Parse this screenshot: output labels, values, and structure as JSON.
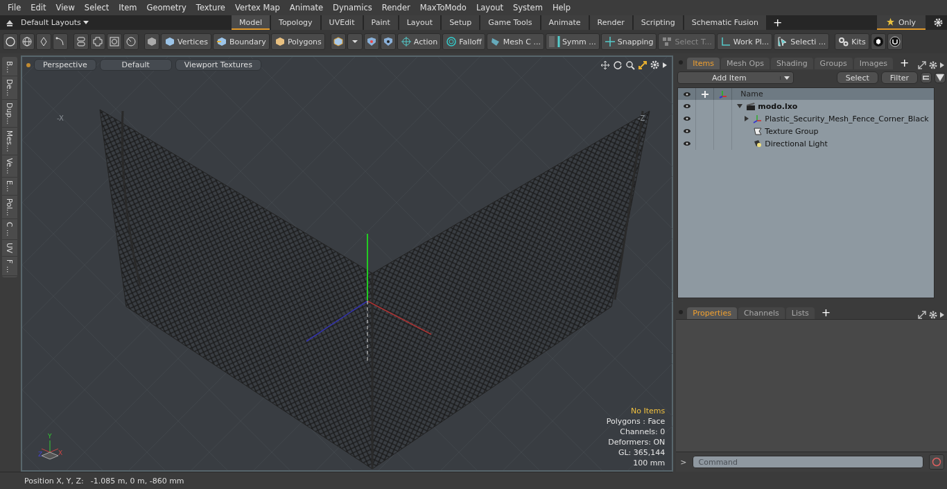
{
  "menu_bar": [
    "File",
    "Edit",
    "View",
    "Select",
    "Item",
    "Geometry",
    "Texture",
    "Vertex Map",
    "Animate",
    "Dynamics",
    "Render",
    "MaxToModo",
    "Layout",
    "System",
    "Help"
  ],
  "layout_bar": {
    "layouts_menu": "Default Layouts",
    "tabs": [
      {
        "label": "Model",
        "selected": true
      },
      {
        "label": "Topology",
        "selected": false
      },
      {
        "label": "UVEdit",
        "selected": false
      },
      {
        "label": "Paint",
        "selected": false
      },
      {
        "label": "Layout",
        "selected": false
      },
      {
        "label": "Setup",
        "selected": false
      },
      {
        "label": "Game Tools",
        "selected": false
      },
      {
        "label": "Animate",
        "selected": false
      },
      {
        "label": "Render",
        "selected": false
      },
      {
        "label": "Scripting",
        "selected": false
      },
      {
        "label": "Schematic Fusion",
        "selected": false
      }
    ],
    "add_tab": "+",
    "only_button": "Only"
  },
  "toolbar": [
    {
      "kind": "icon"
    },
    {
      "kind": "icon"
    },
    {
      "kind": "icon"
    },
    {
      "kind": "icon"
    },
    {
      "kind": "icon"
    },
    {
      "kind": "icon"
    },
    {
      "kind": "icon"
    },
    {
      "kind": "icon"
    },
    {
      "kind": "icon"
    },
    {
      "kind": "text",
      "label": "Vertices",
      "disabled": false
    },
    {
      "kind": "text",
      "label": "Boundary",
      "disabled": false
    },
    {
      "kind": "text",
      "label": "Polygons",
      "disabled": false
    },
    {
      "kind": "icon"
    },
    {
      "kind": "icon"
    },
    {
      "kind": "icon"
    },
    {
      "kind": "icon"
    },
    {
      "kind": "text",
      "label": "Action",
      "disabled": false
    },
    {
      "kind": "text",
      "label": "Falloff",
      "disabled": false
    },
    {
      "kind": "text",
      "label": "Mesh C ...",
      "disabled": false
    },
    {
      "kind": "text",
      "label": "Symm ...",
      "disabled": false
    },
    {
      "kind": "text",
      "label": "Snapping",
      "disabled": false
    },
    {
      "kind": "text",
      "label": "Select T...",
      "disabled": true
    },
    {
      "kind": "text",
      "label": "Work Pl...",
      "disabled": false
    },
    {
      "kind": "text",
      "label": "Selecti ...",
      "disabled": false
    },
    {
      "kind": "text",
      "label": "Kits",
      "disabled": false
    },
    {
      "kind": "icon"
    },
    {
      "kind": "icon"
    }
  ],
  "side_tabs": [
    "B...",
    "De...",
    "Dup...",
    "Mes...",
    "Ve...",
    "E...",
    "Pol...",
    "C ...",
    "UV",
    "F ..."
  ],
  "viewport": {
    "buttons": [
      "Perspective",
      "Default",
      "Viewport Textures"
    ],
    "axis_labels": [
      "-X",
      "-Z"
    ],
    "gizmo_labels": [
      "Y",
      "Z",
      "X"
    ],
    "info": [
      {
        "text": "No Items",
        "highlight": true
      },
      {
        "text": "Polygons : Face",
        "highlight": false
      },
      {
        "text": "Channels: 0",
        "highlight": false
      },
      {
        "text": "Deformers: ON",
        "highlight": false
      },
      {
        "text": "GL: 365,144",
        "highlight": false
      },
      {
        "text": "100 mm",
        "highlight": false
      }
    ]
  },
  "items_panel": {
    "tabs": [
      {
        "label": "Items",
        "selected": true
      },
      {
        "label": "Mesh Ops",
        "selected": false
      },
      {
        "label": "Shading",
        "selected": false
      },
      {
        "label": "Groups",
        "selected": false
      },
      {
        "label": "Images",
        "selected": false
      }
    ],
    "add_tab": "+",
    "add_item": "Add Item",
    "select_button": "Select",
    "filter_button": "Filter",
    "name_column": "Name",
    "tree": [
      {
        "name": "modo.lxo",
        "kind": "scene",
        "expanded": true,
        "children": [
          {
            "name": "Plastic_Security_Mesh_Fence_Corner_Black",
            "kind": "mesh",
            "expanded": false
          },
          {
            "name": "Texture Group",
            "kind": "texture"
          },
          {
            "name": "Directional Light",
            "kind": "light"
          }
        ]
      }
    ]
  },
  "properties_panel": {
    "tabs": [
      {
        "label": "Properties",
        "selected": true
      },
      {
        "label": "Channels",
        "selected": false
      },
      {
        "label": "Lists",
        "selected": false
      }
    ],
    "add_tab": "+"
  },
  "command": {
    "prompt": ">",
    "placeholder": "Command"
  },
  "status_bar": {
    "label": "Position X, Y, Z:",
    "value": "-1.085 m, 0 m, -860 mm"
  }
}
